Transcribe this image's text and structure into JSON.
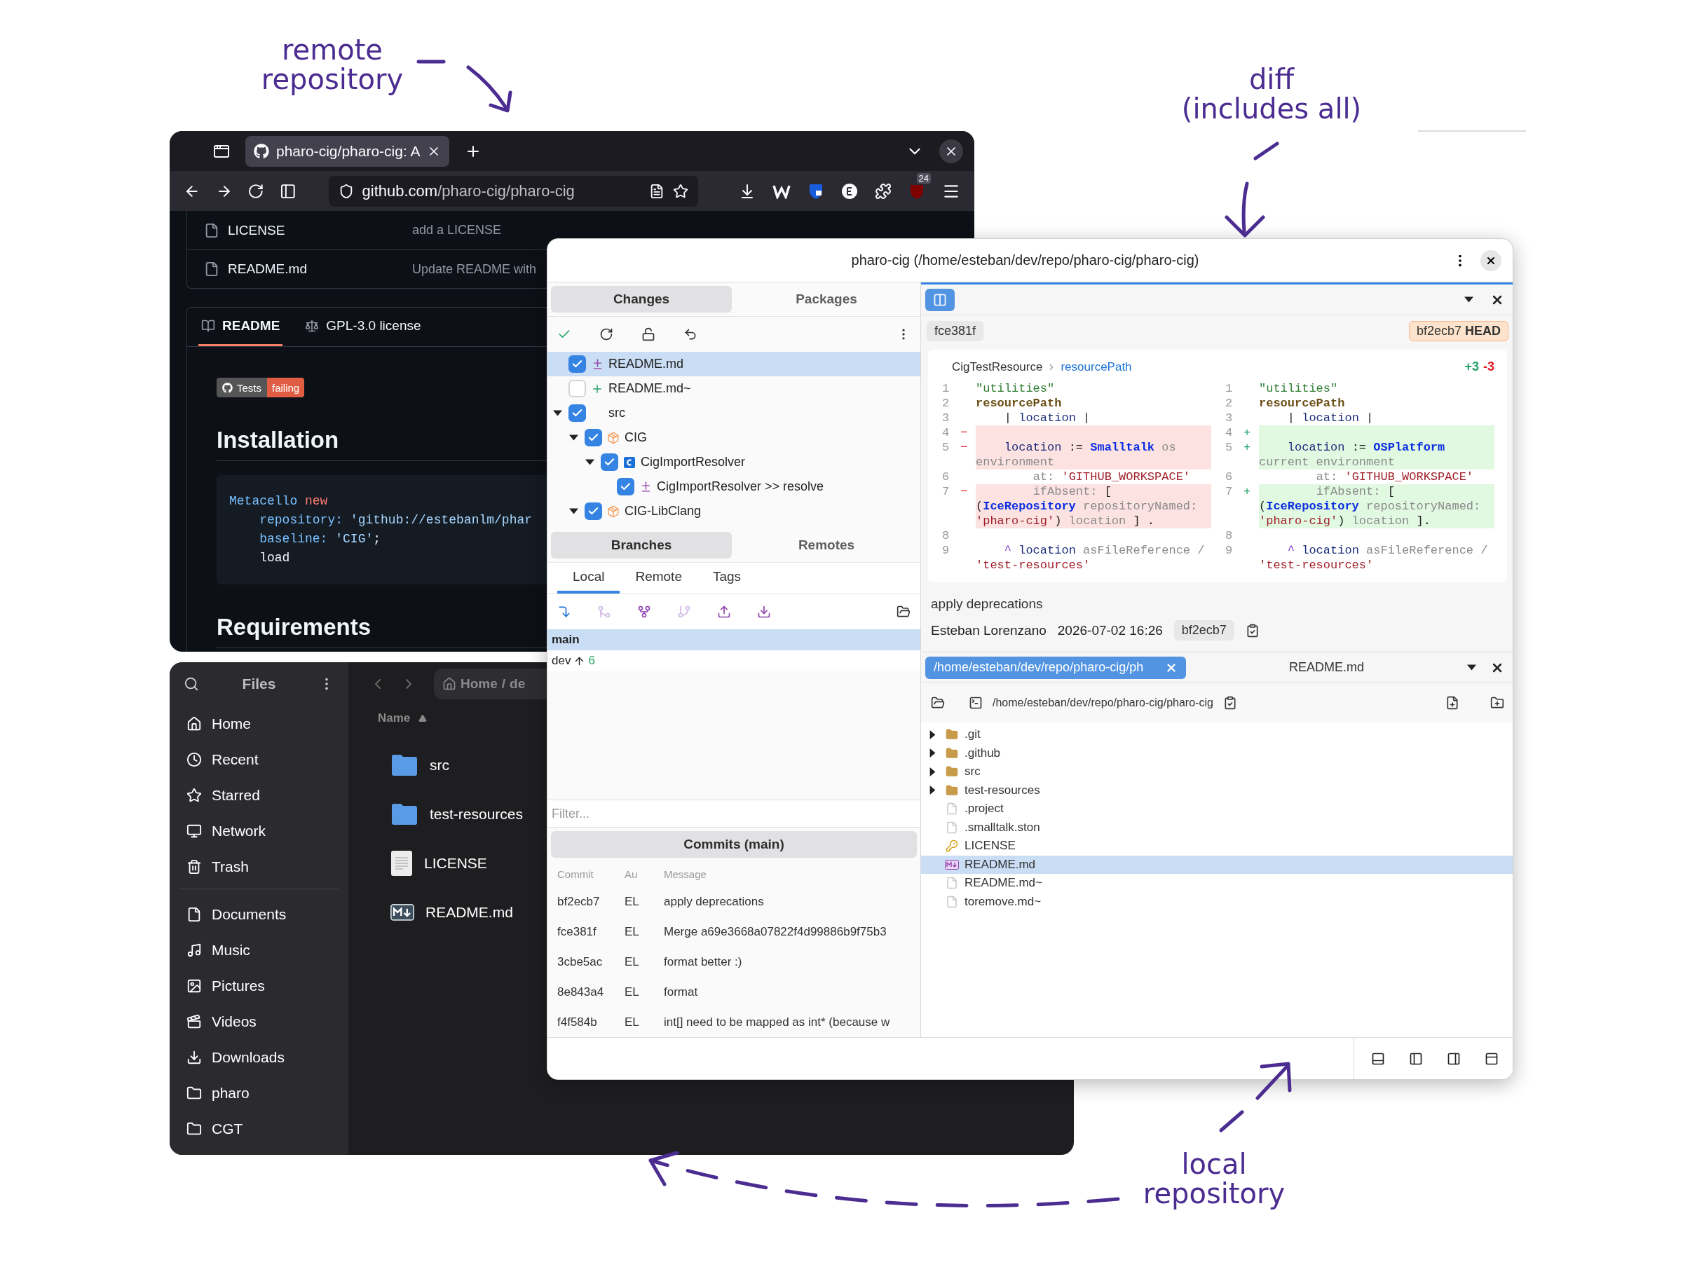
{
  "annotations": [
    {
      "kind": "remote",
      "lines": [
        "remote",
        "repository"
      ]
    },
    {
      "kind": "diff",
      "lines": [
        "diff",
        "(includes all)"
      ]
    },
    {
      "kind": "local",
      "lines": [
        "local",
        "repository"
      ]
    }
  ],
  "browser": {
    "tab": {
      "title": "pharo-cig/pharo-cig: A",
      "selected": true
    },
    "url": {
      "domain": "github.com",
      "path": "/pharo-cig/pharo-cig"
    },
    "extension_badge": "24",
    "files": [
      {
        "name": "LICENSE",
        "message": "add a LICENSE"
      },
      {
        "name": "README.md",
        "message": "Update README with"
      }
    ],
    "readme_tabs": [
      {
        "kind": "book",
        "label": "README",
        "selected": true
      },
      {
        "kind": "scale",
        "label": "GPL-3.0 license",
        "selected": false
      }
    ],
    "badge": {
      "label": "Tests",
      "status": "failing"
    },
    "content": [
      {
        "kind": "heading",
        "text": "Installation"
      },
      {
        "kind": "code",
        "lines": [
          [
            {
              "text": "Metacello",
              "kind": "class"
            },
            {
              "text": " new",
              "kind": "keyword"
            }
          ],
          [
            {
              "text": "    repository: ",
              "kind": "key"
            },
            {
              "text": "'github://estebanlm/phar",
              "kind": "string"
            }
          ],
          [
            {
              "text": "    baseline: ",
              "kind": "key"
            },
            {
              "text": "'CIG'",
              "kind": "string"
            },
            {
              "text": ";",
              "kind": "plain"
            }
          ],
          [
            {
              "text": "    load",
              "kind": "plain"
            }
          ]
        ]
      },
      {
        "kind": "heading",
        "text": "Requirements"
      }
    ]
  },
  "files_window": {
    "title": "Files",
    "places": [
      {
        "kind": "home",
        "label": "Home"
      },
      {
        "kind": "recent",
        "label": "Recent"
      },
      {
        "kind": "starred",
        "label": "Starred"
      },
      {
        "kind": "network",
        "label": "Network"
      },
      {
        "kind": "trash",
        "label": "Trash"
      }
    ],
    "bookmarks": [
      {
        "kind": "documents",
        "label": "Documents"
      },
      {
        "kind": "music",
        "label": "Music"
      },
      {
        "kind": "pictures",
        "label": "Pictures"
      },
      {
        "kind": "videos",
        "label": "Videos"
      },
      {
        "kind": "downloads",
        "label": "Downloads"
      },
      {
        "kind": "folder",
        "label": "pharo"
      },
      {
        "kind": "folder",
        "label": "CGT"
      }
    ],
    "breadcrumb": [
      "Home",
      "/",
      "de"
    ],
    "column": "Name",
    "items": [
      {
        "kind": "folder",
        "name": "src"
      },
      {
        "kind": "folder",
        "name": "test-resources"
      },
      {
        "kind": "text",
        "name": "LICENSE"
      },
      {
        "kind": "markdown",
        "name": "README.md"
      }
    ]
  },
  "git_window": {
    "title": "pharo-cig (/home/esteban/dev/repo/pharo-cig/pharo-cig)",
    "changes_tabs": [
      {
        "label": "Changes",
        "selected": true
      },
      {
        "label": "Packages",
        "selected": false
      }
    ],
    "changes_tree": [
      {
        "kind": "modified",
        "label": "README.md",
        "checked": true,
        "selected": true
      },
      {
        "kind": "added",
        "label": "README.md~",
        "checked": false,
        "selected": false
      },
      {
        "kind": "folder",
        "label": "src",
        "checked": true,
        "selected": false,
        "expanded": true,
        "children": [
          {
            "kind": "package",
            "label": "CIG",
            "checked": true,
            "selected": false,
            "expanded": true,
            "children": [
              {
                "kind": "class",
                "label": "CigImportResolver",
                "checked": true,
                "selected": false,
                "expanded": true,
                "children": [
                  {
                    "kind": "modified",
                    "label": "CigImportResolver >> resolve",
                    "checked": true,
                    "selected": false
                  }
                ]
              }
            ]
          },
          {
            "kind": "package",
            "label": "CIG-LibClang",
            "checked": true,
            "selected": false,
            "expanded": true
          }
        ]
      }
    ],
    "branch_tabs": [
      {
        "label": "Branches",
        "selected": true
      },
      {
        "label": "Remotes",
        "selected": false
      }
    ],
    "scope_tabs": [
      {
        "label": "Local",
        "selected": true
      },
      {
        "label": "Remote",
        "selected": false
      },
      {
        "label": "Tags",
        "selected": false
      }
    ],
    "branch_tools": [
      {
        "kind": "checkout",
        "disabled": false
      },
      {
        "kind": "merge",
        "disabled": true
      },
      {
        "kind": "fork",
        "disabled": false
      },
      {
        "kind": "rebase",
        "disabled": true
      },
      {
        "kind": "push",
        "disabled": false
      },
      {
        "kind": "pull",
        "disabled": false
      }
    ],
    "branches": [
      {
        "name": "main",
        "selected": true
      },
      {
        "name": "dev",
        "selected": false,
        "ahead": "6"
      }
    ],
    "filter": {
      "placeholder": "Filter..."
    },
    "commits": {
      "title": "Commits (main)",
      "columns": [
        "Commit",
        "Au",
        "Message"
      ],
      "rows": [
        [
          "bf2ecb7",
          "EL",
          "apply deprecations"
        ],
        [
          "fce381f",
          "EL",
          "Merge a69e3668a07822f4d99886b9f75b3"
        ],
        [
          "3cbe5ac",
          "EL",
          "format better :)"
        ],
        [
          "8e843a4",
          "EL",
          "format"
        ],
        [
          "f4f584b",
          "EL",
          "int[] need to be mapped as int* (because w"
        ]
      ]
    },
    "diff": {
      "base": "fce381f",
      "head": "bf2ecb7 **HEAD**",
      "class_name": "CigTestResource",
      "method": "resourcePath",
      "added": "+3",
      "removed": "-3",
      "left": [
        {
          "num": "1",
          "kind": "unchanged",
          "tokens": [
            {
              "text": "\"utilities\"",
              "kind": "comment"
            }
          ]
        },
        {
          "num": "2",
          "kind": "unchanged",
          "tokens": [
            {
              "text": "resourcePath",
              "kind": "selector"
            }
          ]
        },
        {
          "num": "3",
          "kind": "unchanged",
          "tokens": [
            {
              "text": "    |",
              "kind": "punct"
            },
            {
              "text": " location",
              "kind": "var"
            },
            {
              "text": " |",
              "kind": "punct"
            }
          ]
        },
        {
          "num": "4",
          "kind": "removed",
          "sign": "−"
        },
        {
          "num": "5",
          "kind": "removed",
          "sign": "−",
          "tokens": [
            {
              "text": "    location",
              "kind": "var"
            },
            {
              "text": " := ",
              "kind": "punct"
            },
            {
              "text": "Smalltalk",
              "kind": "global"
            },
            {
              "text": " os environment",
              "kind": "msg"
            }
          ]
        },
        {
          "num": "6",
          "kind": "unchanged",
          "tokens": [
            {
              "text": "        at: ",
              "kind": "msg"
            },
            {
              "text": "'GITHUB_WORKSPACE'",
              "kind": "string"
            }
          ]
        },
        {
          "num": "7",
          "kind": "removed",
          "sign": "−",
          "tokens": [
            {
              "text": "        ifAbsent: ",
              "kind": "msg"
            },
            {
              "text": "[ (",
              "kind": "punct"
            },
            {
              "text": "IceRepository",
              "kind": "global"
            },
            {
              "text": " repositoryNamed: ",
              "kind": "msg"
            },
            {
              "text": "'pharo-cig'",
              "kind": "string"
            },
            {
              "text": ")",
              "kind": "punct"
            },
            {
              "text": " location",
              "kind": "msg"
            },
            {
              "text": " ] .",
              "kind": "punct"
            }
          ]
        },
        {
          "num": "8",
          "kind": "unchanged"
        },
        {
          "num": "9",
          "kind": "unchanged",
          "tokens": [
            {
              "text": "    ^",
              "kind": "caret"
            },
            {
              "text": " location",
              "kind": "var"
            },
            {
              "text": " asFileReference / ",
              "kind": "msg"
            },
            {
              "text": "'test-resources'",
              "kind": "string"
            }
          ]
        }
      ],
      "right": [
        {
          "num": "1",
          "kind": "unchanged",
          "tokens": [
            {
              "text": "\"utilities\"",
              "kind": "comment"
            }
          ]
        },
        {
          "num": "2",
          "kind": "unchanged",
          "tokens": [
            {
              "text": "resourcePath",
              "kind": "selector"
            }
          ]
        },
        {
          "num": "3",
          "kind": "unchanged",
          "tokens": [
            {
              "text": "    |",
              "kind": "punct"
            },
            {
              "text": " location",
              "kind": "var"
            },
            {
              "text": " |",
              "kind": "punct"
            }
          ]
        },
        {
          "num": "4",
          "kind": "added",
          "sign": "+"
        },
        {
          "num": "5",
          "kind": "added",
          "sign": "+",
          "tokens": [
            {
              "text": "    location",
              "kind": "var"
            },
            {
              "text": " := ",
              "kind": "punct"
            },
            {
              "text": "OSPlatform",
              "kind": "global"
            },
            {
              "text": " current environment",
              "kind": "msg"
            }
          ]
        },
        {
          "num": "6",
          "kind": "unchanged",
          "tokens": [
            {
              "text": "        at: ",
              "kind": "msg"
            },
            {
              "text": "'GITHUB_WORKSPACE'",
              "kind": "string"
            }
          ]
        },
        {
          "num": "7",
          "kind": "added",
          "sign": "+",
          "tokens": [
            {
              "text": "        ifAbsent: ",
              "kind": "msg"
            },
            {
              "text": "[ (",
              "kind": "punct"
            },
            {
              "text": "IceRepository",
              "kind": "global"
            },
            {
              "text": " repositoryNamed: ",
              "kind": "msg"
            },
            {
              "text": "'pharo-cig'",
              "kind": "string"
            },
            {
              "text": ")",
              "kind": "punct"
            },
            {
              "text": " location",
              "kind": "msg"
            },
            {
              "text": " ].",
              "kind": "punct"
            }
          ]
        },
        {
          "num": "8",
          "kind": "unchanged"
        },
        {
          "num": "9",
          "kind": "unchanged",
          "tokens": [
            {
              "text": "    ^",
              "kind": "caret"
            },
            {
              "text": " location",
              "kind": "var"
            },
            {
              "text": " asFileReference / ",
              "kind": "msg"
            },
            {
              "text": "'test-resources'",
              "kind": "string"
            }
          ]
        }
      ]
    },
    "commit": {
      "message": "apply deprecations",
      "author": "Esteban Lorenzano",
      "date": "2026-07-02 16:26",
      "hash": "bf2ecb7"
    },
    "file_panel": {
      "tab": {
        "label": "/home/esteban/dev/repo/pharo-cig/ph",
        "selected": true
      },
      "title": "README.md",
      "path": "/home/esteban/dev/repo/pharo-cig/pharo-cig",
      "tree": [
        {
          "kind": "folder",
          "name": ".git",
          "expanded": false,
          "selected": false
        },
        {
          "kind": "folder",
          "name": ".github",
          "expanded": false,
          "selected": false
        },
        {
          "kind": "folder",
          "name": "src",
          "expanded": false,
          "selected": false
        },
        {
          "kind": "folder",
          "name": "test-resources",
          "expanded": false,
          "selected": false
        },
        {
          "kind": "file",
          "name": ".project",
          "selected": false
        },
        {
          "kind": "file",
          "name": ".smalltalk.ston",
          "selected": false
        },
        {
          "kind": "license",
          "name": "LICENSE",
          "selected": false
        },
        {
          "kind": "markdown",
          "name": "README.md",
          "selected": true
        },
        {
          "kind": "file",
          "name": "README.md~",
          "selected": false
        },
        {
          "kind": "file",
          "name": "toremove.md~",
          "selected": false
        }
      ]
    },
    "layout_buttons": [
      {
        "kind": "bottom"
      },
      {
        "kind": "left"
      },
      {
        "kind": "right"
      },
      {
        "kind": "top"
      }
    ]
  }
}
